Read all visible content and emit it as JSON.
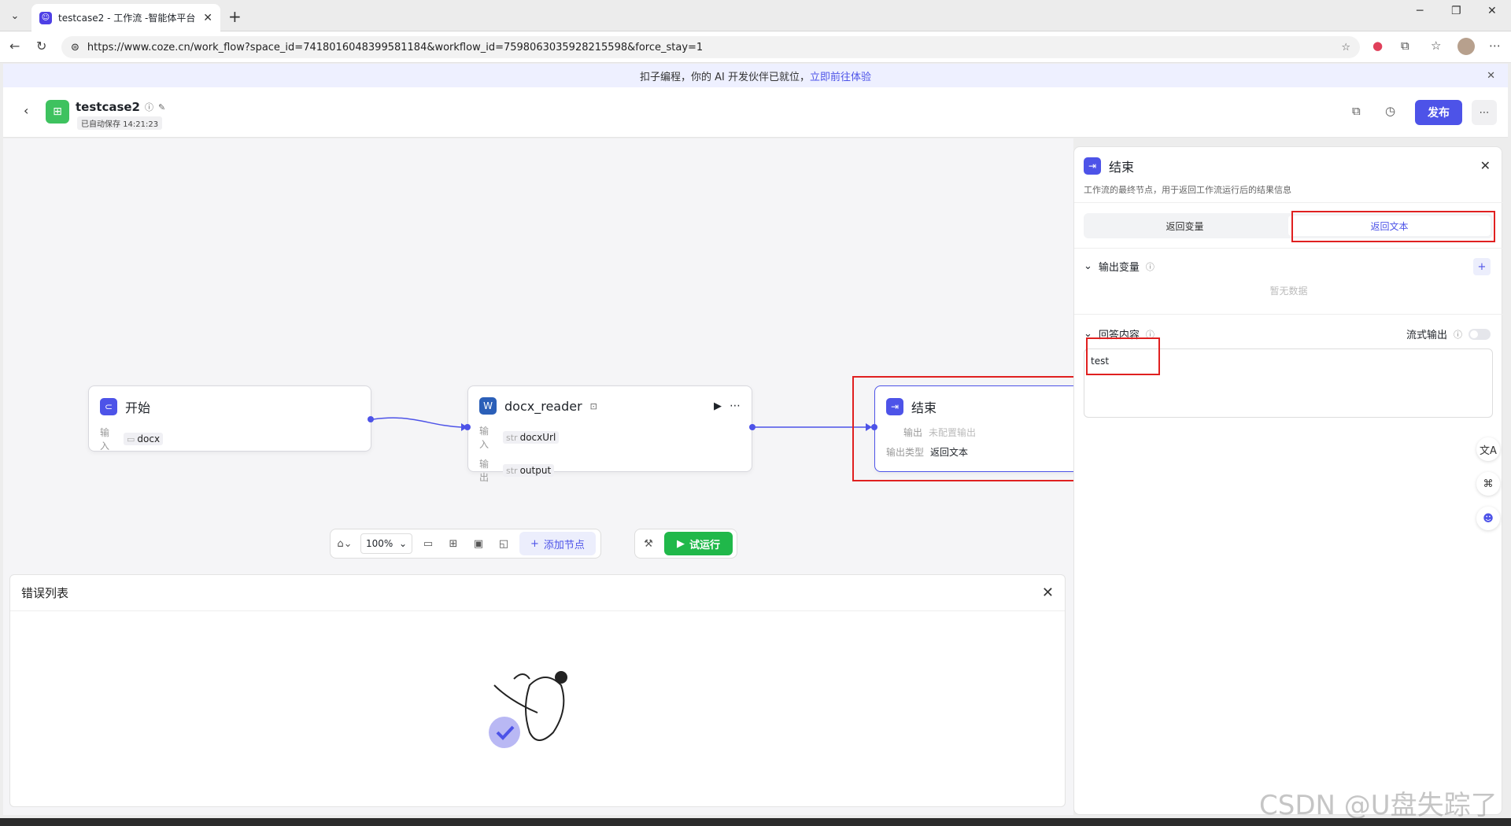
{
  "browser": {
    "tab_title": "testcase2 - 工作流 -智能体平台",
    "url": "https://www.coze.cn/work_flow?space_id=7418016048399581184&workflow_id=7598063035928215598&force_stay=1"
  },
  "banner": {
    "text": "扣子编程，你的 AI 开发伙伴已就位，",
    "link": "立即前往体验"
  },
  "header": {
    "workflow_name": "testcase2",
    "saved_text": "已自动保存 14:21:23",
    "publish_label": "发布"
  },
  "nodes": {
    "start": {
      "title": "开始",
      "input_label": "输入",
      "input_value": "docx"
    },
    "docx": {
      "title": "docx_reader",
      "input_label": "输入",
      "input_type": "str",
      "input_value": "docxUrl",
      "output_label": "输出",
      "output_type": "str",
      "output_value": "output"
    },
    "end": {
      "title": "结束",
      "output_label": "输出",
      "output_value": "未配置输出",
      "type_label": "输出类型",
      "type_value": "返回文本"
    }
  },
  "toolbar": {
    "zoom": "100%",
    "add_node": "添加节点",
    "trial_run": "试运行"
  },
  "error_panel": {
    "title": "错误列表"
  },
  "side_panel": {
    "title": "结束",
    "description": "工作流的最终节点，用于返回工作流运行后的结果信息",
    "tab_variable": "返回变量",
    "tab_text": "返回文本",
    "section_output": "输出变量",
    "no_data": "暂无数据",
    "section_answer": "回答内容",
    "stream_output": "流式输出",
    "answer_value": "test"
  },
  "watermark": "CSDN @U盘失踪了",
  "colors": {
    "accent": "#4d53e8",
    "run_green": "#20b84a",
    "highlight_red": "#e02020"
  }
}
